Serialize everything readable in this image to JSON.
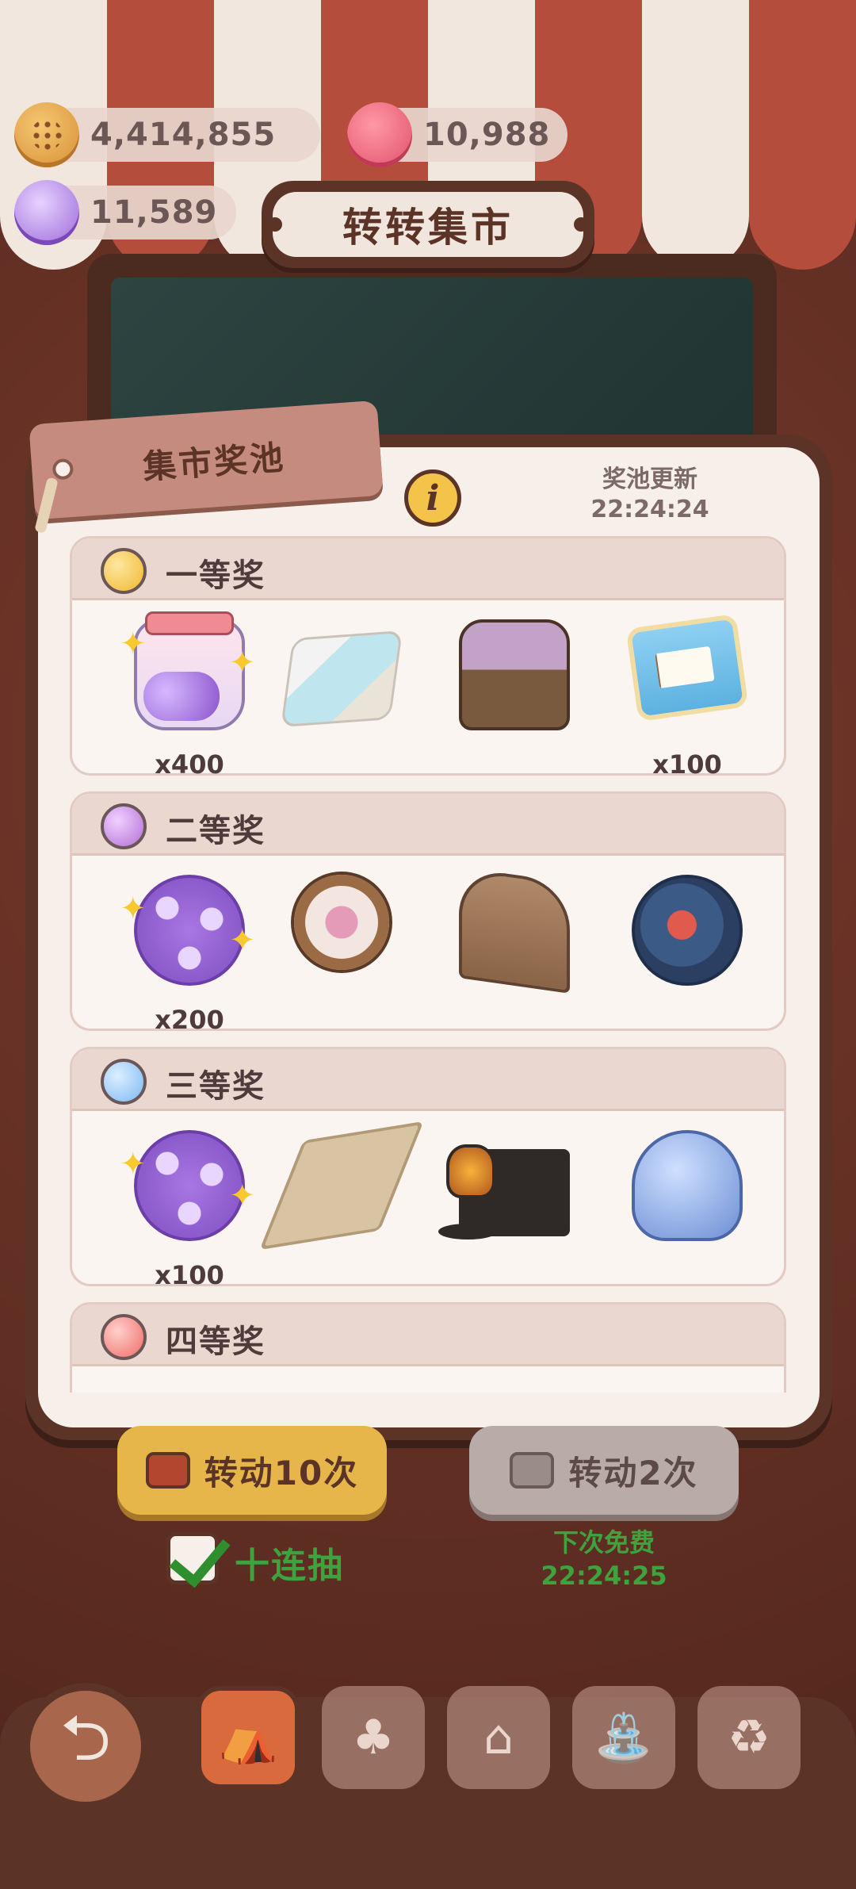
{
  "currency": {
    "cookies": "4,414,855",
    "gummies": "10,988",
    "candies": "11,589"
  },
  "header": {
    "title": "转转集市"
  },
  "panel": {
    "tag_title": "集市奖池",
    "refresh_label": "奖池更新",
    "refresh_time": "22:24:24"
  },
  "tiers": [
    {
      "name": "一等奖",
      "gem_color": "#f2b72e",
      "items": [
        {
          "icon": "candy-jar",
          "qty": "x400"
        },
        {
          "icon": "hot-spring",
          "qty": ""
        },
        {
          "icon": "cookie-lounge-chair",
          "qty": ""
        },
        {
          "icon": "recipe-book",
          "qty": "x100"
        }
      ]
    },
    {
      "name": "二等奖",
      "gem_color": "#b36fd6",
      "items": [
        {
          "icon": "magic-candies",
          "qty": "x200"
        },
        {
          "icon": "ship-wheel",
          "qty": ""
        },
        {
          "icon": "wooden-bridge",
          "qty": ""
        },
        {
          "icon": "round-rug",
          "qty": ""
        }
      ]
    },
    {
      "name": "三等奖",
      "gem_color": "#7cb8f2",
      "items": [
        {
          "icon": "magic-candies",
          "qty": "x100"
        },
        {
          "icon": "floor-tile",
          "qty": ""
        },
        {
          "icon": "street-lamp",
          "qty": ""
        },
        {
          "icon": "jellyfish",
          "qty": ""
        }
      ]
    },
    {
      "name": "四等奖",
      "gem_color": "#ef6c67",
      "items": []
    }
  ],
  "actions": {
    "spin10_label": "转动10次",
    "spin2_label": "转动2次",
    "ten_draw_label": "十连抽",
    "free_next_label": "下次免费",
    "free_next_time": "22:24:25"
  },
  "nav": {
    "back_icon": "back-arrow-icon",
    "items": [
      "market",
      "bunny-shop",
      "mushroom-house",
      "fountain",
      "recycle-bin"
    ]
  }
}
